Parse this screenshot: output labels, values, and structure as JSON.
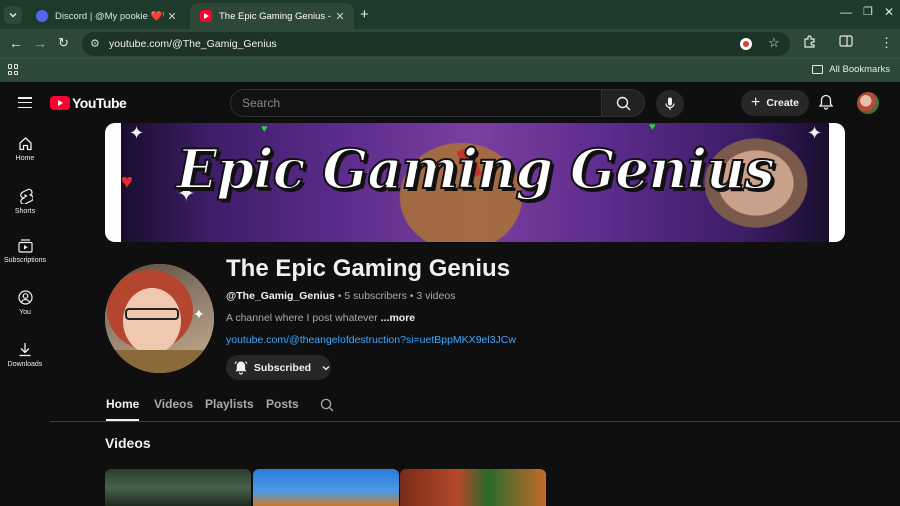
{
  "browser": {
    "tabs": [
      {
        "title": "Discord | @My pookie ❤️❤️💦",
        "active": false
      },
      {
        "title": "The Epic Gaming Genius - YouT",
        "active": true
      }
    ],
    "url": "youtube.com/@The_Gamig_Genius",
    "bookmarks_label": "All Bookmarks"
  },
  "header": {
    "logo_text": "YouTube",
    "search_placeholder": "Search",
    "create_label": "Create"
  },
  "guide": {
    "items": [
      {
        "label": "Home",
        "icon": "home-icon"
      },
      {
        "label": "Shorts",
        "icon": "shorts-icon"
      },
      {
        "label": "Subscriptions",
        "icon": "subscriptions-icon"
      },
      {
        "label": "You",
        "icon": "you-icon"
      },
      {
        "label": "Downloads",
        "icon": "downloads-icon"
      }
    ]
  },
  "channel": {
    "banner_text": "Epic Gaming Genius",
    "name": "The Epic Gaming Genius",
    "handle": "@The_Gamig_Genius",
    "subscribers": "5 subscribers",
    "videos": "3 videos",
    "description": "A channel where I post whatever ",
    "more_label": "...more",
    "link": "youtube.com/@theangelofdestruction?si=uetBppMKX9el3JCw",
    "subscribe_label": "Subscribed"
  },
  "tabs": [
    "Home",
    "Videos",
    "Playlists",
    "Posts"
  ],
  "sections": {
    "videos_heading": "Videos"
  },
  "colors": {
    "background": "#0f0f0f",
    "brand_red": "#ff0033",
    "link_blue": "#3ea6ff",
    "browser_chrome": "#2e4837"
  }
}
